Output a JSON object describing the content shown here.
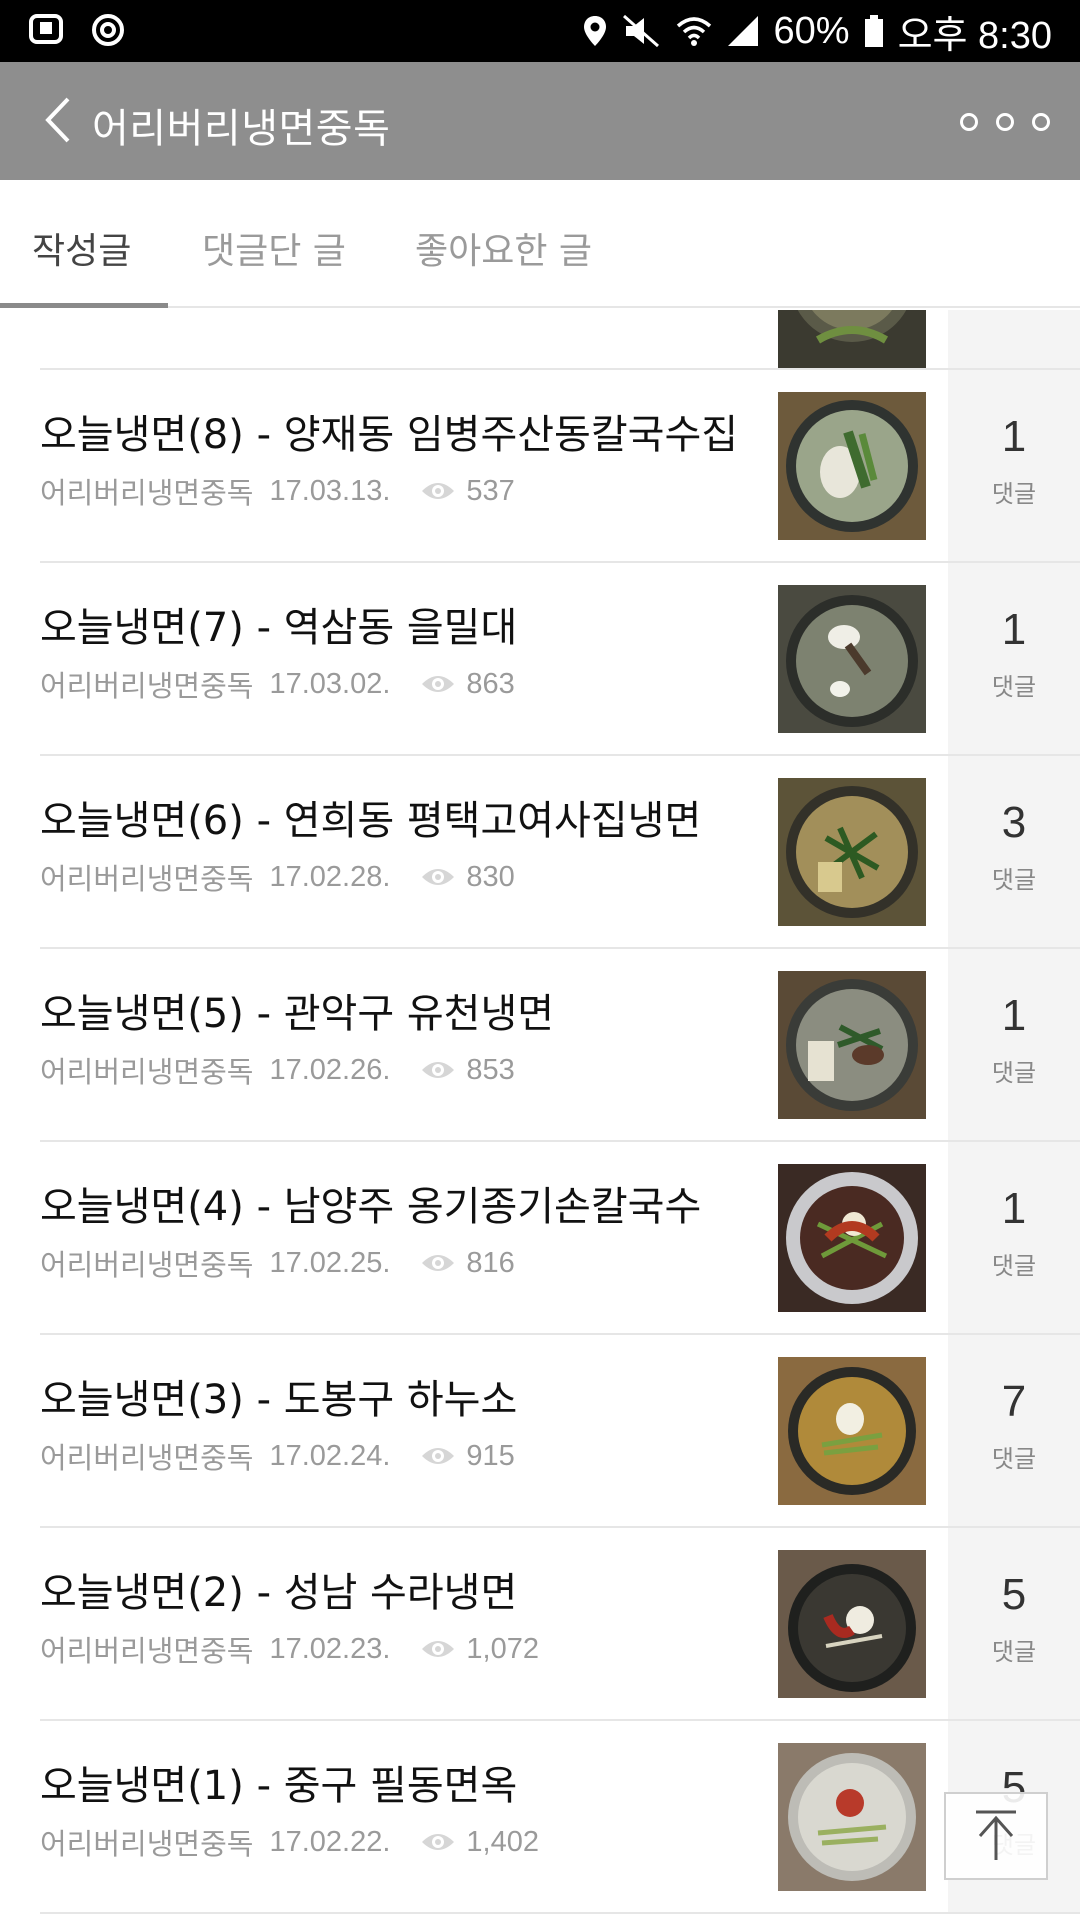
{
  "status_bar": {
    "battery": "60%",
    "time": "오후 8:30"
  },
  "header": {
    "title": "어리버리냉면중독"
  },
  "tabs": [
    {
      "label": "작성글",
      "active": true
    },
    {
      "label": "댓글단 글",
      "active": false
    },
    {
      "label": "좋아요한 글",
      "active": false
    }
  ],
  "posts": [
    {
      "title": "오늘냉면(8) - 양재동 임병주산동칼국수집",
      "author": "어리버리냉면중독",
      "date": "17.03.13.",
      "views": "537",
      "comments": "1",
      "comments_label": "댓글"
    },
    {
      "title": "오늘냉면(7) - 역삼동 을밀대",
      "author": "어리버리냉면중독",
      "date": "17.03.02.",
      "views": "863",
      "comments": "1",
      "comments_label": "댓글"
    },
    {
      "title": "오늘냉면(6) - 연희동 평택고여사집냉면",
      "author": "어리버리냉면중독",
      "date": "17.02.28.",
      "views": "830",
      "comments": "3",
      "comments_label": "댓글"
    },
    {
      "title": "오늘냉면(5) - 관악구 유천냉면",
      "author": "어리버리냉면중독",
      "date": "17.02.26.",
      "views": "853",
      "comments": "1",
      "comments_label": "댓글"
    },
    {
      "title": "오늘냉면(4) - 남양주 옹기종기손칼국수",
      "author": "어리버리냉면중독",
      "date": "17.02.25.",
      "views": "816",
      "comments": "1",
      "comments_label": "댓글"
    },
    {
      "title": "오늘냉면(3) - 도봉구 하누소",
      "author": "어리버리냉면중독",
      "date": "17.02.24.",
      "views": "915",
      "comments": "7",
      "comments_label": "댓글"
    },
    {
      "title": "오늘냉면(2) - 성남 수라냉면",
      "author": "어리버리냉면중독",
      "date": "17.02.23.",
      "views": "1,072",
      "comments": "5",
      "comments_label": "댓글"
    },
    {
      "title": "오늘냉면(1) - 중구 필동면옥",
      "author": "어리버리냉면중독",
      "date": "17.02.22.",
      "views": "1,402",
      "comments": "5",
      "comments_label": "댓글"
    }
  ],
  "colors": {
    "app_bar": "#8e8e8e",
    "status_bar": "#000000",
    "count_column": "#f4f4f4",
    "muted_text": "#9a9a9a"
  },
  "icons": {
    "back": "chevron-left-icon",
    "more": "more-dots-icon",
    "views": "eye-icon",
    "scroll_top": "arrow-up-icon"
  }
}
